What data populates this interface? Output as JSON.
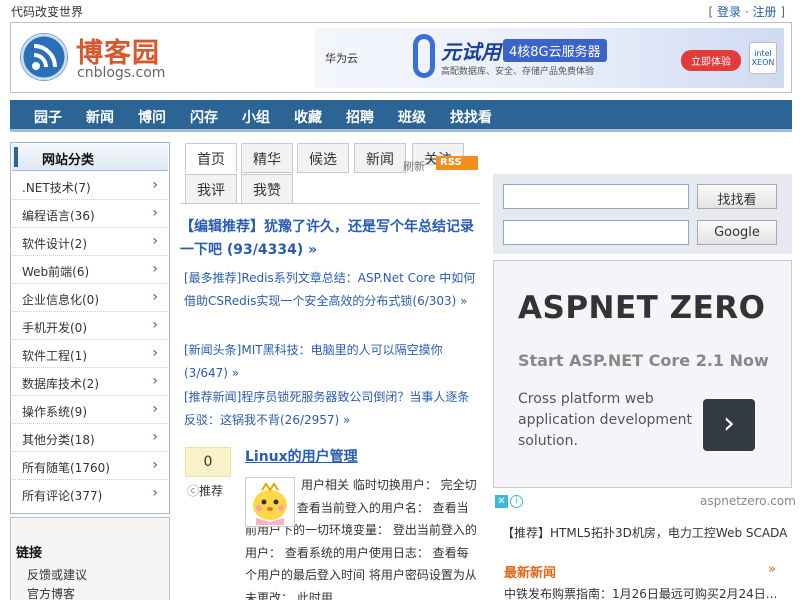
{
  "top": {
    "tagline": "代码改变世界",
    "login": "登录",
    "sep": "·",
    "register": "注册",
    "bracket_open": "[",
    "bracket_close": "]"
  },
  "logo": {
    "cn": "博客园",
    "en": "cnblogs.com"
  },
  "banner": {
    "brand": "华为云",
    "title": "元试用",
    "spec": "4核8G云服务器",
    "sub": "高配数据库、安全、存储产品免费体验",
    "cta": "立即体验",
    "chip": "intel XEON"
  },
  "nav": [
    "园子",
    "新闻",
    "博问",
    "闪存",
    "小组",
    "收藏",
    "招聘",
    "班级",
    "找找看"
  ],
  "categories": {
    "title": "网站分类",
    "items": [
      ".NET技术(7)",
      "编程语言(36)",
      "软件设计(2)",
      "Web前端(6)",
      "企业信息化(0)",
      "手机开发(0)",
      "软件工程(1)",
      "数据库技术(2)",
      "操作系统(9)",
      "其他分类(18)",
      "所有随笔(1760)",
      "所有评论(377)"
    ]
  },
  "links": {
    "title": "链接",
    "items": [
      "反馈或建议",
      "官方博客"
    ]
  },
  "tabs": {
    "row1": [
      "首页",
      "精华",
      "候选",
      "新闻",
      "关注"
    ],
    "row2": [
      "我评",
      "我赞"
    ],
    "refresh": "刷新",
    "rss": "RSS"
  },
  "headline": "【编辑推荐】犹豫了许久，还是写个年总结记录一下吧 (93/4334) »",
  "recommendations": [
    "[最多推荐]Redis系列文章总结：ASP.Net Core 中如何借助CSRedis实现一个安全高效的分布式锁(6/303) »",
    "[新闻头条]MIT黑科技：电脑里的人可以隔空摸你(3/647) »",
    "[推荐新闻]程序员锁死服务器致公司倒闭？当事人逐条反驳：这锅我不背(26/2957) »"
  ],
  "post": {
    "votes": "0",
    "recommend": "推荐",
    "title": "Linux的用户管理",
    "summary": "用户相关 临时切换用户： 完全切换用户： 查看当前登入的用户名： 查看当前用户下的一切环境变量： 登出当前登入的用户： 查看系统的用户使用日志： 查看每个用户的最后登入时间 将用户密码设置为从未更改： 此时用"
  },
  "search": {
    "btn1": "找找看",
    "btn2": "Google"
  },
  "ad": {
    "title": "ASPNET ZERO",
    "sub": "Start ASP.NET Core 2.1 Now",
    "desc": "Cross platform web application development solution.",
    "arrow": "›",
    "domain": "aspnetzero.com",
    "choice_x": "✕",
    "choice_i": "i"
  },
  "promo": "【推荐】HTML5拓扑3D机房，电力工控Web SCADA",
  "news": {
    "title": "最新新闻",
    "more": "»",
    "item": "中铁发布购票指南：1月26日最远可购买2月24日..."
  }
}
